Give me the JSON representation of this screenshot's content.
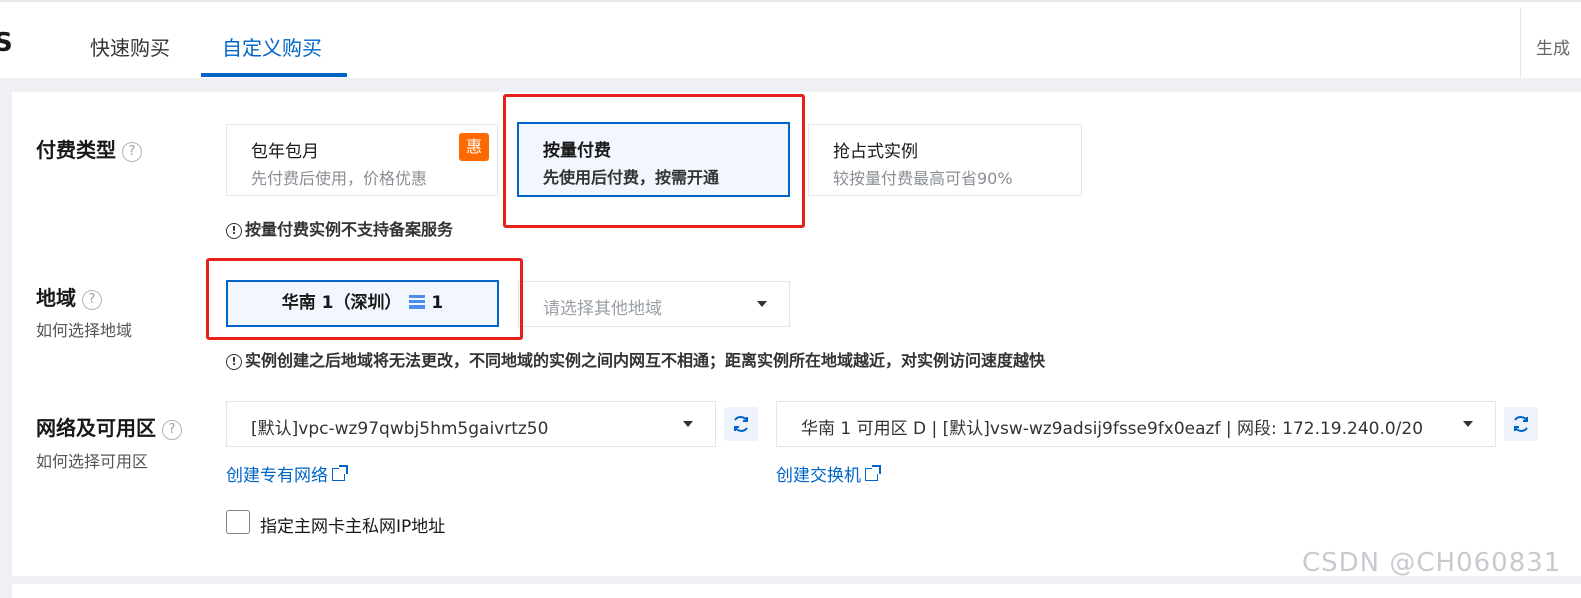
{
  "header": {
    "brand_fragment": "S",
    "tabs": [
      {
        "label": "快速购买",
        "active": false
      },
      {
        "label": "自定义购买",
        "active": true
      }
    ],
    "right_text": "生成"
  },
  "billing": {
    "label": "付费类型",
    "help_icon": "question-circle-icon",
    "options": [
      {
        "title": "包年包月",
        "desc": "先付费后使用，价格优惠",
        "badge": "惠",
        "selected": false
      },
      {
        "title": "按量付费",
        "desc": "先使用后付费，按需开通",
        "selected": true
      },
      {
        "title": "抢占式实例",
        "desc": "较按量付费最高可省90%",
        "selected": false
      }
    ],
    "notice": "按量付费实例不支持备案服务"
  },
  "region": {
    "label": "地域",
    "sublabel": "如何选择地域",
    "selected": "华南 1（深圳）",
    "selected_count": "1",
    "other_placeholder": "请选择其他地域",
    "notice": "实例创建之后地域将无法更改，不同地域的实例之间内网互不相通；距离实例所在地域越近，对实例访问速度越快"
  },
  "network": {
    "label": "网络及可用区",
    "sublabel": "如何选择可用区",
    "vpc_value": "[默认]vpc-wz97qwbj5hm5gaivrtz50",
    "vswitch_value": "华南 1 可用区 D | [默认]vsw-wz9adsij9fsse9fx0eazf | 网段: 172.19.240.0/20",
    "create_vpc_link": "创建专有网络",
    "create_vswitch_link": "创建交换机",
    "private_ip_checkbox": "指定主网卡主私网IP地址",
    "private_ip_checked": false
  },
  "watermark": "CSDN @CH060831",
  "colors": {
    "accent": "#0064c8",
    "highlight_red": "#e8201c",
    "promo_orange": "#ff6a00"
  }
}
